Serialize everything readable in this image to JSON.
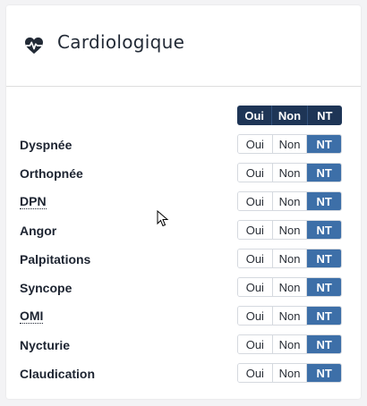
{
  "panel": {
    "title": "Cardiologique",
    "icon": "heartbeat-icon"
  },
  "legend": {
    "yes": "Oui",
    "no": "Non",
    "nt": "NT"
  },
  "options": {
    "yes": "Oui",
    "no": "Non",
    "nt": "NT"
  },
  "colors": {
    "legend_bg": "#1e3556",
    "active_bg": "#3d6fa8"
  },
  "rows": [
    {
      "label": "Dyspnée",
      "selected": "NT"
    },
    {
      "label": "Orthopnée",
      "selected": "NT"
    },
    {
      "label": "DPN",
      "selected": "NT",
      "abbr": true
    },
    {
      "label": "Angor",
      "selected": "NT"
    },
    {
      "label": "Palpitations",
      "selected": "NT"
    },
    {
      "label": "Syncope",
      "selected": "NT"
    },
    {
      "label": "OMI",
      "selected": "NT",
      "abbr": true
    },
    {
      "label": "Nycturie",
      "selected": "NT"
    },
    {
      "label": "Claudication",
      "selected": "NT"
    }
  ]
}
